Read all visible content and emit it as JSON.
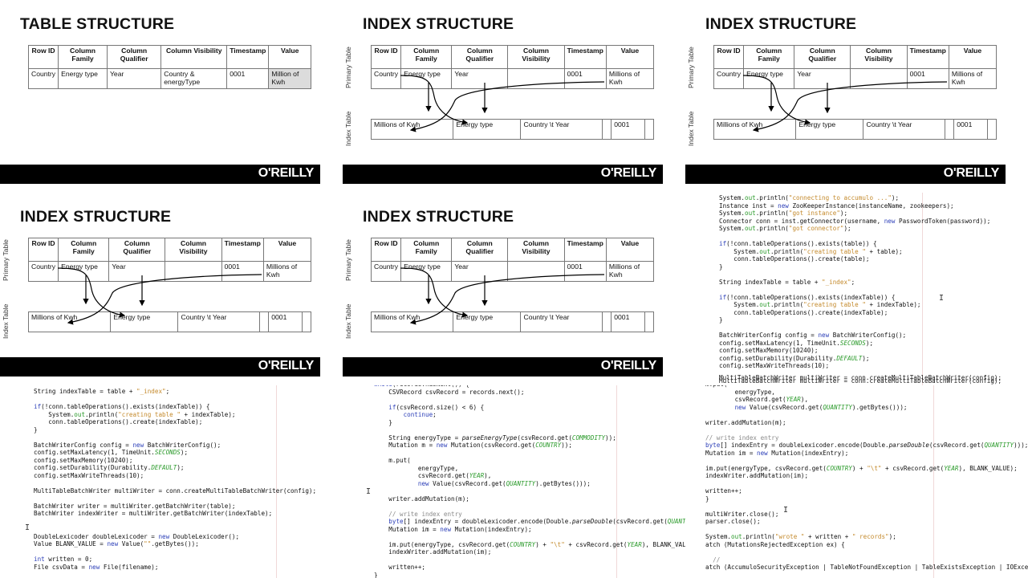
{
  "brand": {
    "logo": "O'REILLY",
    "footer_color": "#000000"
  },
  "table_headers": [
    "Row ID",
    "Column Family",
    "Column Qualifier",
    "Column Visibility",
    "Timestamp",
    "Value"
  ],
  "table_structure": {
    "title": "TABLE STRUCTURE",
    "row": [
      "Country",
      "Energy type",
      "Year",
      "Country & energyType",
      "0001",
      "Million of Kwh"
    ]
  },
  "index_structure": {
    "title": "INDEX STRUCTURE",
    "primary_label": "Primary Table",
    "index_label": "Index Table",
    "primary_row": [
      "Country",
      "Energy type",
      "Year",
      "",
      "0001",
      "Millions of Kwh"
    ],
    "index_row": [
      "Millions of Kwh",
      "Energy type",
      "Country \\t Year",
      "",
      "0001",
      ""
    ]
  },
  "code_panel_1": {
    "lines": [
      "System.out.println(\"connecting to accumulo ...\");",
      "Instance inst = new ZooKeeperInstance(instanceName, zookeepers);",
      "System.out.println(\"got instance\");",
      "Connector conn = inst.getConnector(username, new PasswordToken(password));",
      "System.out.println(\"got connector\");",
      "",
      "if(!conn.tableOperations().exists(table)) {",
      "    System.out.println(\"creating table \" + table);",
      "    conn.tableOperations().create(table);",
      "}",
      "",
      "String indexTable = table + \"_index\";",
      "",
      "if(!conn.tableOperations().exists(indexTable)) {",
      "    System.out.println(\"creating table \" + indexTable);",
      "    conn.tableOperations().create(indexTable);",
      "}",
      "",
      "BatchWriterConfig config = new BatchWriterConfig();",
      "config.setMaxLatency(1, TimeUnit.SECONDS);",
      "config.setMaxMemory(10240);",
      "config.setDurability(Durability.DEFAULT);",
      "config.setMaxWriteThreads(10);",
      "",
      "MultiTableBatchWriter multiWriter = conn.createMultiTableBatchWriter(config);"
    ]
  },
  "code_panel_2": {
    "lines": [
      "String indexTable = table + \"_index\";",
      "",
      "if(!conn.tableOperations().exists(indexTable)) {",
      "    System.out.println(\"creating table \" + indexTable);",
      "    conn.tableOperations().create(indexTable);",
      "}",
      "",
      "BatchWriterConfig config = new BatchWriterConfig();",
      "config.setMaxLatency(1, TimeUnit.SECONDS);",
      "config.setMaxMemory(10240);",
      "config.setDurability(Durability.DEFAULT);",
      "config.setMaxWriteThreads(10);",
      "",
      "MultiTableBatchWriter multiWriter = conn.createMultiTableBatchWriter(config);",
      "",
      "BatchWriter writer = multiWriter.getBatchWriter(table);",
      "BatchWriter indexWriter = multiWriter.getBatchWriter(indexTable);",
      "",
      "",
      "DoubleLexicoder doubleLexicoder = new DoubleLexicoder();",
      "Value BLANK_VALUE = new Value(\"\".getBytes());",
      "",
      "int written = 0;",
      "File csvData = new File(filename);"
    ]
  },
  "code_panel_3": {
    "lines": [
      "while(records.hasNext()) {",
      "    CSVRecord csvRecord = records.next();",
      "",
      "    if(csvRecord.size() < 6) {",
      "        continue;",
      "    }",
      "",
      "    String energyType = parseEnergyType(csvRecord.get(COMMODITY));",
      "    Mutation m = new Mutation(csvRecord.get(COUNTRY));",
      "",
      "    m.put(",
      "            energyType,",
      "            csvRecord.get(YEAR),",
      "            new Value(csvRecord.get(QUANTITY).getBytes()));",
      "",
      "    writer.addMutation(m);",
      "",
      "    // write index entry",
      "    byte[] indexEntry = doubleLexicoder.encode(Double.parseDouble(csvRecord.get(QUANTIT",
      "    Mutation im = new Mutation(indexEntry);",
      "",
      "    im.put(energyType, csvRecord.get(COUNTRY) + \"\\t\" + csvRecord.get(YEAR), BLANK_VALUE",
      "    indexWriter.addMutation(im);",
      "",
      "    written++;",
      "}"
    ]
  },
  "code_panel_4": {
    "lines": [
      "m.put(",
      "        energyType,",
      "        csvRecord.get(YEAR),",
      "        new Value(csvRecord.get(QUANTITY).getBytes()));",
      "",
      "writer.addMutation(m);",
      "",
      "// write index entry",
      "byte[] indexEntry = doubleLexicoder.encode(Double.parseDouble(csvRecord.get(QUANTITY)));",
      "Mutation im = new Mutation(indexEntry);",
      "",
      "im.put(energyType, csvRecord.get(COUNTRY) + \"\\t\" + csvRecord.get(YEAR), BLANK_VALUE);",
      "indexWriter.addMutation(im);",
      "",
      "written++;",
      "}",
      "",
      "multiWriter.close();",
      "parser.close();",
      "",
      "System.out.println(\"wrote \" + written + \" records\");",
      "atch (MutationsRejectedException ex) {",
      "",
      "  //",
      "atch (AccumuloSecurityException | TableNotFoundException | TableExistsException | IOException e"
    ]
  }
}
